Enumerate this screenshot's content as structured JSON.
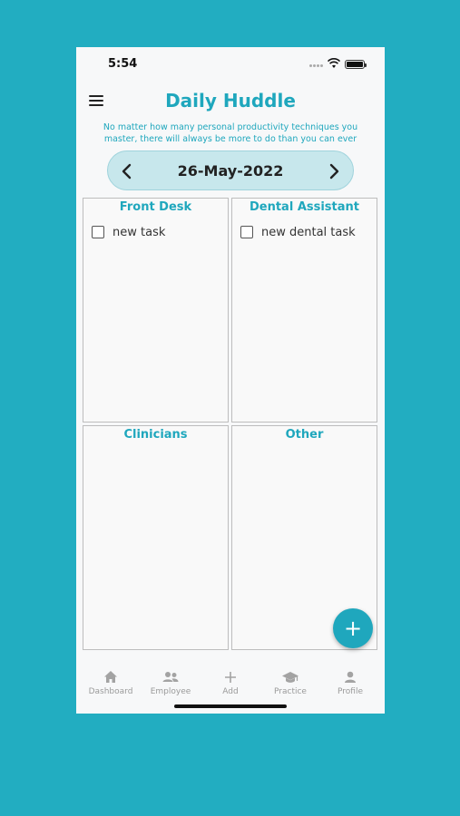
{
  "status": {
    "time": "5:54"
  },
  "header": {
    "title": "Daily Huddle",
    "quote": "No matter how many personal productivity techniques you master, there will always be more to do than you can ever"
  },
  "date_nav": {
    "date": "26-May-2022"
  },
  "panels": [
    {
      "title": "Front Desk",
      "tasks": [
        {
          "label": "new task",
          "checked": false
        }
      ]
    },
    {
      "title": "Dental Assistant",
      "tasks": [
        {
          "label": "new dental task",
          "checked": false
        }
      ]
    },
    {
      "title": "Clinicians",
      "tasks": []
    },
    {
      "title": "Other",
      "tasks": []
    }
  ],
  "fab": {
    "icon": "plus-icon",
    "symbol": "+"
  },
  "bottom_nav": {
    "items": [
      {
        "label": "Dashboard",
        "icon": "home-icon"
      },
      {
        "label": "Employee",
        "icon": "people-icon"
      },
      {
        "label": "Add",
        "icon": "plus-icon"
      },
      {
        "label": "Practice",
        "icon": "graduation-cap-icon"
      },
      {
        "label": "Profile",
        "icon": "person-icon"
      }
    ]
  },
  "colors": {
    "background": "#22adc1",
    "accent": "#1fa7bd",
    "pill": "#c7e7ec",
    "nav_inactive": "#9a9a9a"
  }
}
